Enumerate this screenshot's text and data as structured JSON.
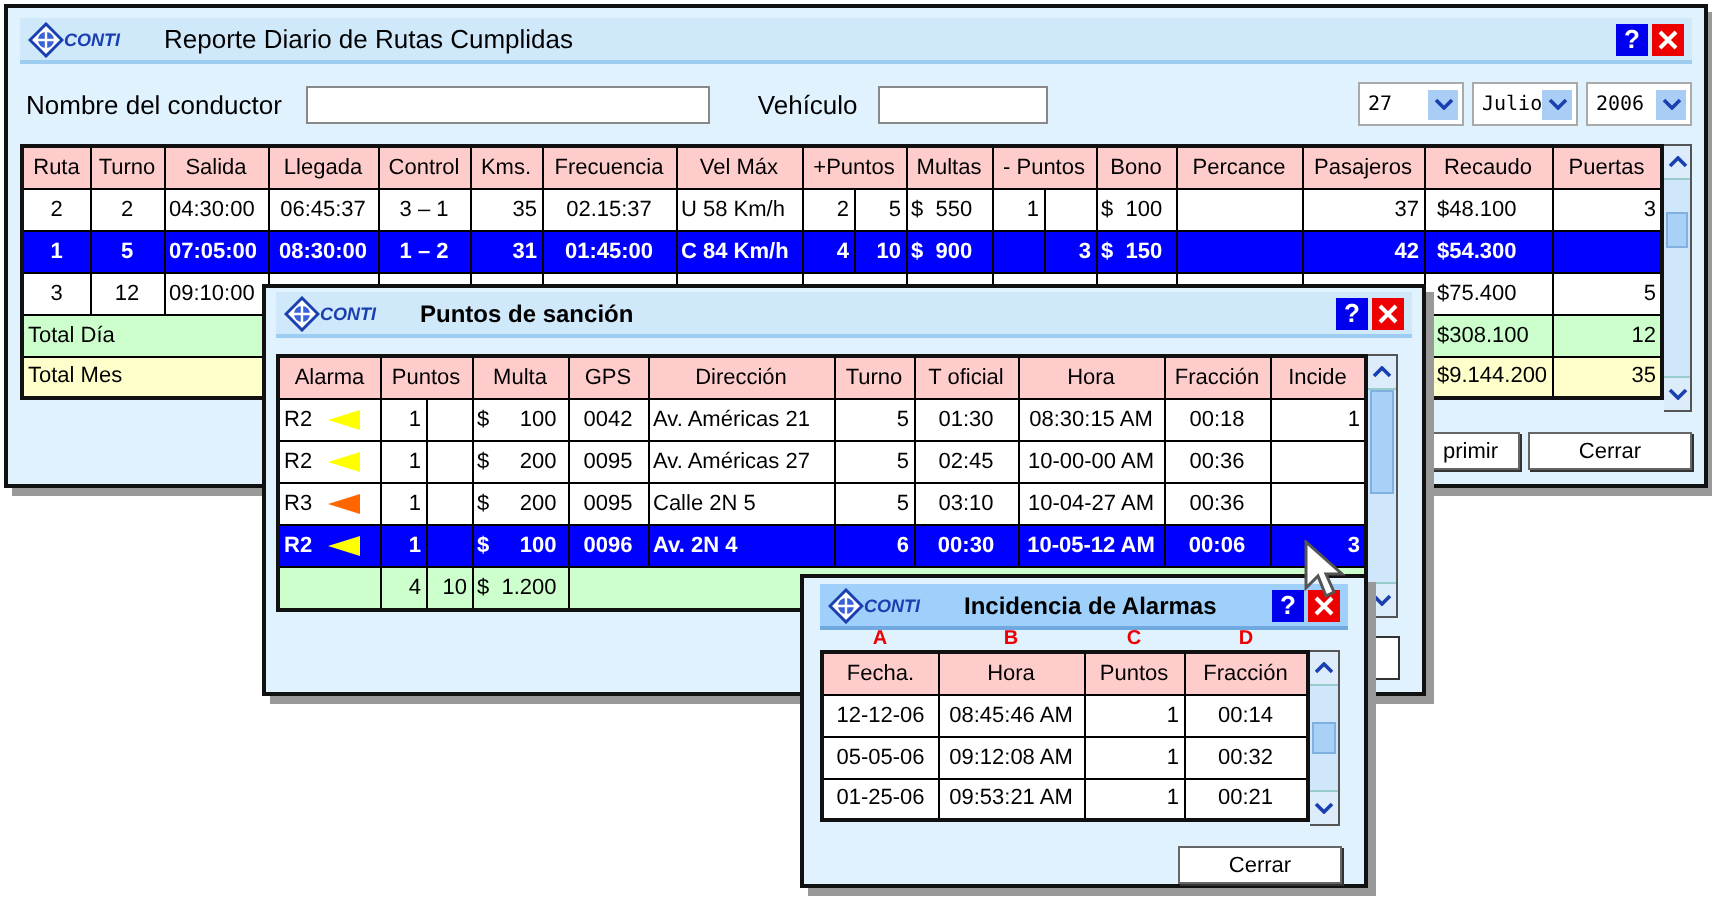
{
  "main_window": {
    "logo": "CONTI",
    "title": "Reporte Diario de Rutas Cumplidas",
    "help": "?",
    "driver_label": "Nombre del conductor",
    "vehicle_label": "Vehículo",
    "date": [
      "27",
      "Julio",
      "2006"
    ],
    "table": {
      "columns": [
        "Ruta",
        "Turno",
        "Salida",
        "Llegada",
        "Control",
        "Kms.",
        "Frecuencia",
        "Vel Máx",
        "+Puntos",
        "Multas",
        "- Puntos",
        "Bono",
        "Percance",
        "Pasajeros",
        "Recaudo",
        "Puertas"
      ],
      "rows": [
        {
          "selected": false,
          "cells": [
            "2",
            "2",
            "04:30:00",
            "06:45:37",
            "3 – 1",
            "35",
            "02.15:37",
            "U 58 Km/h",
            [
              "2",
              "5"
            ],
            "$  550",
            [
              "1",
              null
            ],
            "$  100",
            null,
            "37",
            "$48.100",
            "3"
          ]
        },
        {
          "selected": true,
          "cells": [
            "1",
            "5",
            "07:05:00",
            "08:30:00",
            "1 – 2",
            "31",
            "01:45:00",
            "C 84 Km/h",
            [
              "4",
              "10"
            ],
            "$  900",
            [
              null,
              "3"
            ],
            "$  150",
            null,
            "42",
            "$54.300",
            null
          ]
        },
        {
          "selected": false,
          "cells": [
            "3",
            "12",
            "09:10:00",
            null,
            null,
            null,
            null,
            null,
            null,
            null,
            null,
            null,
            null,
            null,
            "$75.400",
            "5"
          ]
        }
      ],
      "totals": [
        {
          "kind": "day",
          "label": "Total Día",
          "values": [
            "$308.100",
            "12"
          ]
        },
        {
          "kind": "month",
          "label": "Total Mes",
          "values": [
            "$9.144.200",
            "35"
          ]
        }
      ]
    },
    "buttons": [
      "primir",
      "Cerrar"
    ]
  },
  "sanction_dialog": {
    "logo": "CONTI",
    "title": "Puntos de sanción",
    "help": "?",
    "table": {
      "columns": [
        "Alarma",
        "Puntos",
        "Multa",
        "GPS",
        "Dirección",
        "Turno",
        "T oficial",
        "Hora",
        "Fracción",
        "Incide"
      ],
      "rows": [
        {
          "selected": false,
          "cells": [
            {
              "code": "R2",
              "color": "#ffff00"
            },
            [
              "1",
              null
            ],
            "$     100",
            "0042",
            "Av. Américas 21",
            "5",
            "01:30",
            "08:30:15 AM",
            "00:18",
            "1"
          ]
        },
        {
          "selected": false,
          "cells": [
            {
              "code": "R2",
              "color": "#ffff00"
            },
            [
              "1",
              null
            ],
            "$     200",
            "0095",
            "Av. Américas 27",
            "5",
            "02:45",
            "10-00-00 AM",
            "00:36",
            null
          ]
        },
        {
          "selected": false,
          "cells": [
            {
              "code": "R3",
              "color": "#ff6600"
            },
            [
              "1",
              null
            ],
            "$     200",
            "0095",
            "Calle 2N 5",
            "5",
            "03:10",
            "10-04-27 AM",
            "00:36",
            null
          ]
        },
        {
          "selected": true,
          "cells": [
            {
              "code": "R2",
              "color": "#ffff00"
            },
            [
              "1",
              null
            ],
            "$     100",
            "0096",
            "Av. 2N 4",
            "6",
            "00:30",
            "10-05-12 AM",
            "00:06",
            "3"
          ]
        }
      ],
      "total_row": [
        [
          "4",
          "10"
        ],
        "$  1.200"
      ]
    }
  },
  "alarm_dialog": {
    "logo": "CONTI",
    "title": "Incidencia de Alarmas",
    "help": "?",
    "table": {
      "columns": [
        {
          "label": "Fecha.",
          "letter": "A"
        },
        {
          "label": "Hora",
          "letter": "B"
        },
        {
          "label": "Puntos",
          "letter": "C"
        },
        {
          "label": "Fracción",
          "letter": "D"
        }
      ],
      "rows": [
        [
          "12-12-06",
          "08:45:46 AM",
          "1",
          "00:14"
        ],
        [
          "05-05-06",
          "09:12:08 AM",
          "1",
          "00:32"
        ],
        [
          "01-25-06",
          "09:53:21 AM",
          "1",
          "00:21"
        ]
      ]
    },
    "button": "Cerrar"
  }
}
